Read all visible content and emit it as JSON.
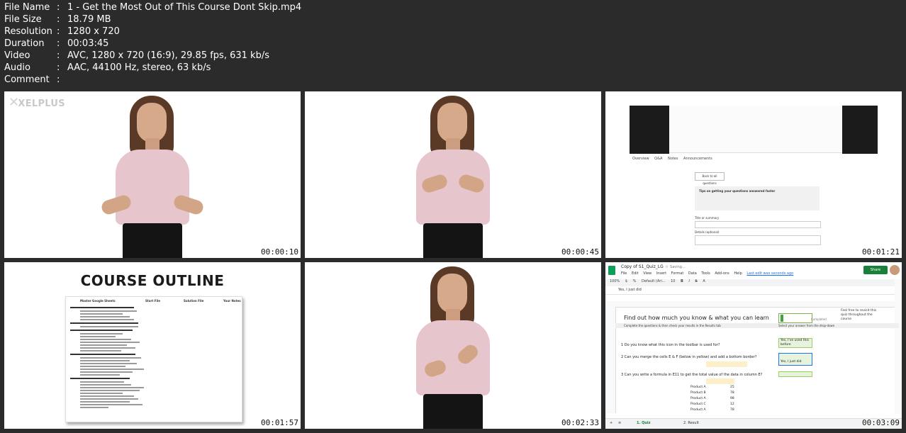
{
  "meta": [
    {
      "key": "File Name",
      "value": "1 - Get the Most Out of This Course Dont Skip.mp4"
    },
    {
      "key": "File Size",
      "value": "18.79 MB"
    },
    {
      "key": "Resolution",
      "value": "1280 x 720"
    },
    {
      "key": "Duration",
      "value": "00:03:45"
    },
    {
      "key": "Video",
      "value": "AVC, 1280 x 720 (16:9), 29.85 fps, 631 kb/s"
    },
    {
      "key": "Audio",
      "value": "AAC, 44100 Hz, stereo, 63 kb/s"
    },
    {
      "key": "Comment",
      "value": ""
    }
  ],
  "meta_separator": ":",
  "thumbnails": {
    "t1": {
      "timestamp": "00:00:10",
      "logo": "XELPLUS"
    },
    "t2": {
      "timestamp": "00:00:45"
    },
    "t3": {
      "timestamp": "00:01:21",
      "tabs": [
        "Overview",
        "Q&A",
        "Notes",
        "Announcements"
      ],
      "back_button": "Back to all questions",
      "tips_title": "Tips on getting your questions answered faster",
      "title_label": "Title or summary",
      "details_label": "Details (optional)"
    },
    "t4": {
      "timestamp": "00:01:57",
      "title": "COURSE OUTLINE",
      "col_headers": [
        "Master Google Sheets",
        "Start File",
        "Solution File",
        "Your Notes"
      ]
    },
    "t5": {
      "timestamp": "00:02:33"
    },
    "t6": {
      "timestamp": "00:03:09",
      "doc_title": "Copy of S1_Quiz_LG",
      "saving": "Saving...",
      "menu": [
        "File",
        "Edit",
        "View",
        "Insert",
        "Format",
        "Data",
        "Tools",
        "Add-ons",
        "Help"
      ],
      "last_edit": "Last edit was seconds ago",
      "share": "Share",
      "zoom": "100%",
      "font": "Default (Ari...",
      "font_size": "10",
      "formula": "Yes, I just did",
      "heading": "Find out how much you know & what you can learn",
      "completed": "Completed",
      "note": "Feel free to revisit this quiz throughout the course",
      "sub_left": "Complete the questions & then check your results in the Results tab",
      "sub_right": "Select your answer from the drop-down",
      "q1": "1   Do you know what this icon in the toolbar is used for?",
      "a1": "Yes, I've used this before",
      "q2": "2   Can you merge the cells E & F (below in yellow) and add a bottom border?",
      "a2": "Yes, I just did",
      "q3": "3   Can you write a formula in E11 to get the total value of the data in column E?",
      "products": [
        {
          "name": "Product A",
          "value": "25"
        },
        {
          "name": "Product B",
          "value": "78"
        },
        {
          "name": "Product A",
          "value": "98"
        },
        {
          "name": "Product C",
          "value": "12"
        },
        {
          "name": "Product A",
          "value": "78"
        }
      ],
      "tabs": [
        "1. Quiz",
        "2. Result"
      ]
    }
  }
}
